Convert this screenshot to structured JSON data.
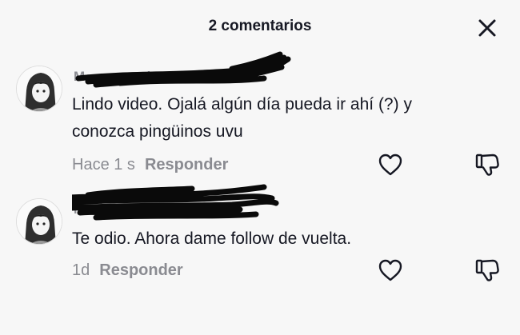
{
  "header": {
    "title": "2 comentarios"
  },
  "comments": [
    {
      "username": "M•••••••••••ky",
      "text": "Lindo video. Ojalá algún día pueda ir ahí (?) y conozca pingüinos uvu",
      "time": "Hace 1 s",
      "reply": "Responder"
    },
    {
      "username": "M•••••••••••ky",
      "text": "Te odio. Ahora dame follow de vuelta.",
      "time": "1d",
      "reply": "Responder"
    }
  ],
  "icons": {
    "close": "close-icon",
    "avatar": "avatar-image",
    "like": "heart-icon",
    "dislike": "thumbs-down-icon"
  },
  "colors": {
    "text": "#161823",
    "muted": "#8a8b91",
    "background": "#f7f7f7"
  }
}
